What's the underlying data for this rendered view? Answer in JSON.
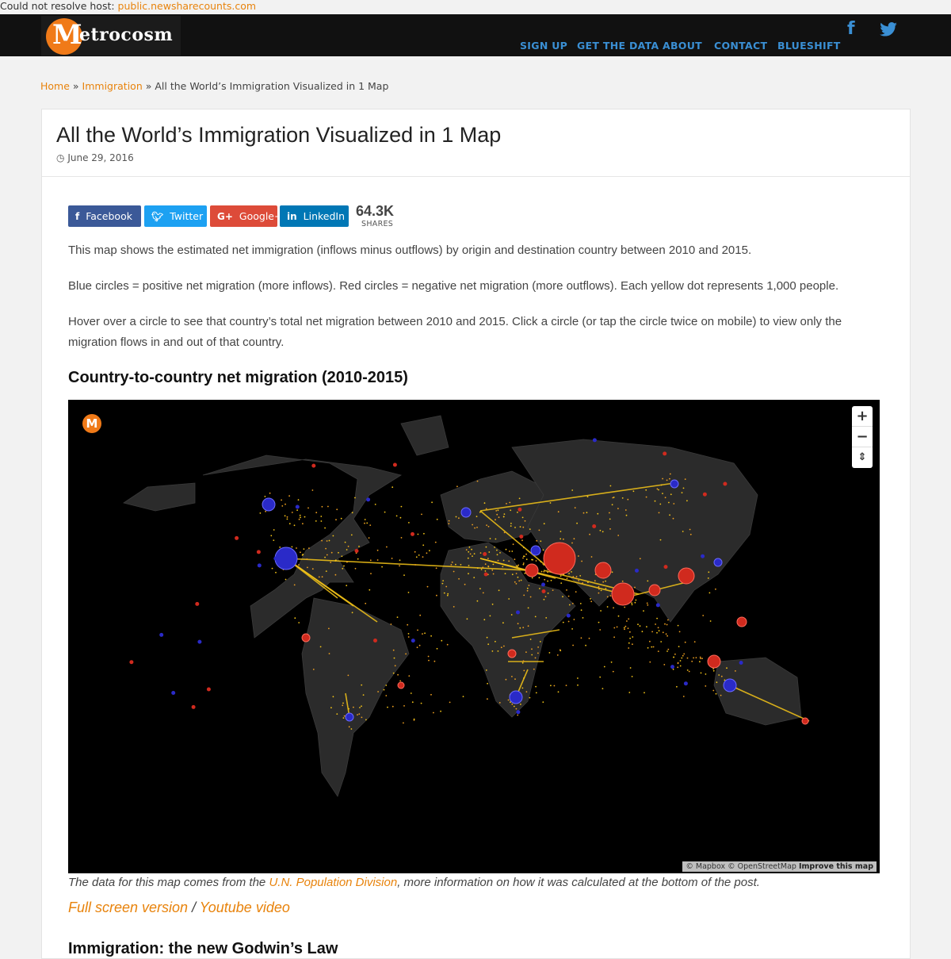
{
  "error": {
    "prefix": "Could not resolve host: ",
    "host": "public.newsharecounts.com"
  },
  "brand": {
    "logo_m": "M",
    "logo_rest": "etrocosm"
  },
  "nav": {
    "signup": "SIGN UP",
    "get_data": "GET THE DATA",
    "about": "ABOUT",
    "contact": "CONTACT",
    "blueshift": "BLUESHIFT"
  },
  "icons": {
    "facebook": "facebook-icon",
    "twitter": "twitter-icon",
    "clock": "clock-icon"
  },
  "colors": {
    "accent": "#e8830c",
    "nav_link": "#3a8fd4",
    "facebook": "#3b5998",
    "twitter": "#1da1f2",
    "google": "#dd4b39",
    "linkedin": "#0077b5",
    "positive_circle": "#2a2ac8",
    "negative_circle": "#d02a1e",
    "flow_dot": "#f5c518"
  },
  "breadcrumb": {
    "home": "Home",
    "sep": "»",
    "category": "Immigration",
    "current": "All the World’s Immigration Visualized in 1 Map"
  },
  "post": {
    "title": "All the World’s Immigration Visualized in 1 Map",
    "date": "June 29, 2016"
  },
  "share": {
    "facebook": "Facebook",
    "twitter": "Twitter",
    "google": "Google+",
    "linkedin": "LinkedIn",
    "count": "64.3K",
    "count_label": "SHARES"
  },
  "body": {
    "p1": "This map shows the estimated net immigration (inflows minus outflows) by origin and destination country between 2010 and 2015.",
    "p2": "Blue circles = positive net migration (more inflows). Red circles = negative net migration (more outflows). Each yellow dot represents 1,000 people.",
    "p3": "Hover over a circle to see that country’s total net migration between 2010 and 2015. Click a circle (or tap the circle twice on mobile) to view only the migration flows in and out of that country.",
    "heading": "Country-to-country net migration (2010-2015)",
    "caption_pre": "The data for this map comes from the ",
    "caption_link": "U.N. Population Division",
    "caption_post": ", more information on how it was calculated at the bottom of the post.",
    "fullscreen": "Full screen version",
    "slash": " / ",
    "youtube": "Youtube video",
    "next_heading": "Immigration: the new Godwin’s Law"
  },
  "map": {
    "logo": "M",
    "zoom_in": "+",
    "zoom_out": "−",
    "compass": "⇕",
    "attribution": "© Mapbox © OpenStreetMap",
    "improve": "Improve this map"
  }
}
